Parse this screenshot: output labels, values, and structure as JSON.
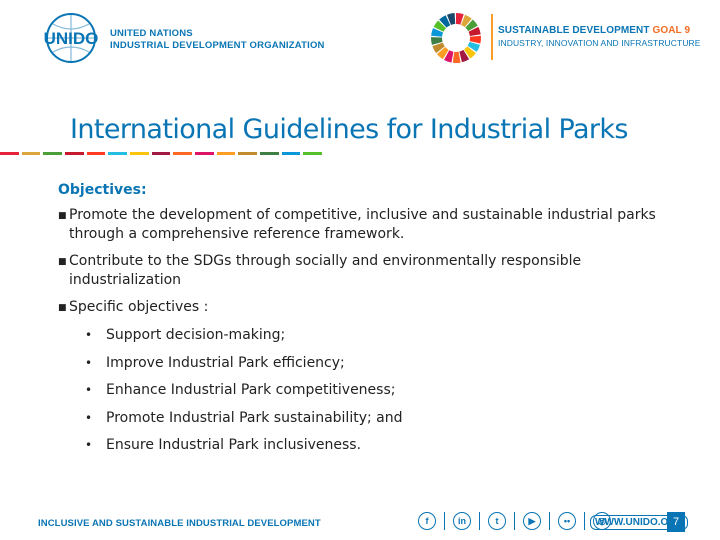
{
  "header": {
    "org_line1": "UNITED NATIONS",
    "org_line2": "INDUSTRIAL DEVELOPMENT ORGANIZATION",
    "sdg_title": "SUSTAINABLE DEVELOPMENT",
    "sdg_goal": "GOAL 9",
    "sdg_subtitle": "INDUSTRY, INNOVATION AND INFRASTRUCTURE",
    "logo_text": "UNIDO"
  },
  "title": "International Guidelines for Industrial Parks",
  "rainbow_colors": [
    "#e5243b",
    "#dda63a",
    "#4c9f38",
    "#c5192d",
    "#ff3a21",
    "#26bde2",
    "#fcc30b",
    "#a21942",
    "#fd6925",
    "#dd1367",
    "#fd9d24",
    "#bf8b2e",
    "#3f7e44",
    "#0a97d9",
    "#56c02b"
  ],
  "objectives_label": "Objectives:",
  "bullets": [
    "Promote the development of competitive, inclusive and sustainable industrial parks through a comprehensive reference framework.",
    "Contribute to the SDGs through socially and environmentally responsible industrialization",
    "Specific objectives :"
  ],
  "sub_bullets": [
    "Support decision-making;",
    "Improve Industrial Park efficiency;",
    "Enhance Industrial Park competitiveness;",
    "Promote Industrial Park sustainability; and",
    "Ensure Industrial Park inclusiveness."
  ],
  "footer": {
    "tagline": "INCLUSIVE AND SUSTAINABLE INDUSTRIAL DEVELOPMENT",
    "website": "WWW.UNIDO.ORG",
    "page": "7",
    "social_icons": [
      "facebook-icon",
      "linkedin-icon",
      "twitter-icon",
      "youtube-icon",
      "flickr-icon",
      "instagram-icon"
    ]
  },
  "colors": {
    "brand_blue": "#0a75b4",
    "sdg_orange": "#f36d25"
  }
}
